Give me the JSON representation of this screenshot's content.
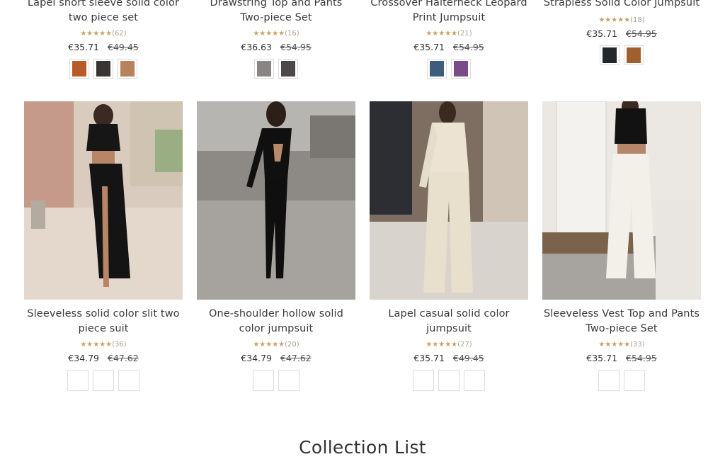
{
  "top_row": [
    {
      "title": "Lapel short sleeve solid color two piece set",
      "stars": "★★★★★",
      "count": "(62)",
      "price": "€35.71",
      "compare": "€49.45",
      "swatch_colors": [
        "#b85a2a",
        "#3a3533",
        "#b8825e"
      ]
    },
    {
      "title": "Drawstring Top and Pants Two-piece Set",
      "stars": "★★★★★",
      "count": "(16)",
      "price": "€36.63",
      "compare": "€54.95",
      "swatch_colors": [
        "#8a8583",
        "#4b4846"
      ]
    },
    {
      "title": "Crossover Halterneck Leopard Print Jumpsuit",
      "stars": "★★★★★",
      "count": "(21)",
      "price": "€35.71",
      "compare": "€54.95",
      "swatch_colors": [
        "#3e5d7a",
        "#7a4a8a"
      ]
    },
    {
      "title": "Strapless Solid Color Jumpsuit",
      "stars": "★★★★★",
      "count": "(18)",
      "price": "€35.71",
      "compare": "€54.95",
      "swatch_colors": [
        "#23262b",
        "#a0602e"
      ]
    }
  ],
  "bottom_row": [
    {
      "title": "Sleeveless solid color slit two piece suit",
      "stars": "★★★★★",
      "count": "(36)",
      "price": "€34.79",
      "compare": "€47.62"
    },
    {
      "title": "One-shoulder hollow solid color jumpsuit",
      "stars": "★★★★★",
      "count": "(20)",
      "price": "€34.79",
      "compare": "€47.62"
    },
    {
      "title": "Lapel casual solid color jumpsuit",
      "stars": "★★★★★",
      "count": "(27)",
      "price": "€35.71",
      "compare": "€49.45"
    },
    {
      "title": "Sleeveless Vest Top and Pants Two-piece Set",
      "stars": "★★★★★",
      "count": "(33)",
      "price": "€35.71",
      "compare": "€54.95"
    }
  ],
  "section": {
    "title": "Collection List"
  },
  "colors": {
    "star": "#c9a063",
    "text": "#333333"
  }
}
